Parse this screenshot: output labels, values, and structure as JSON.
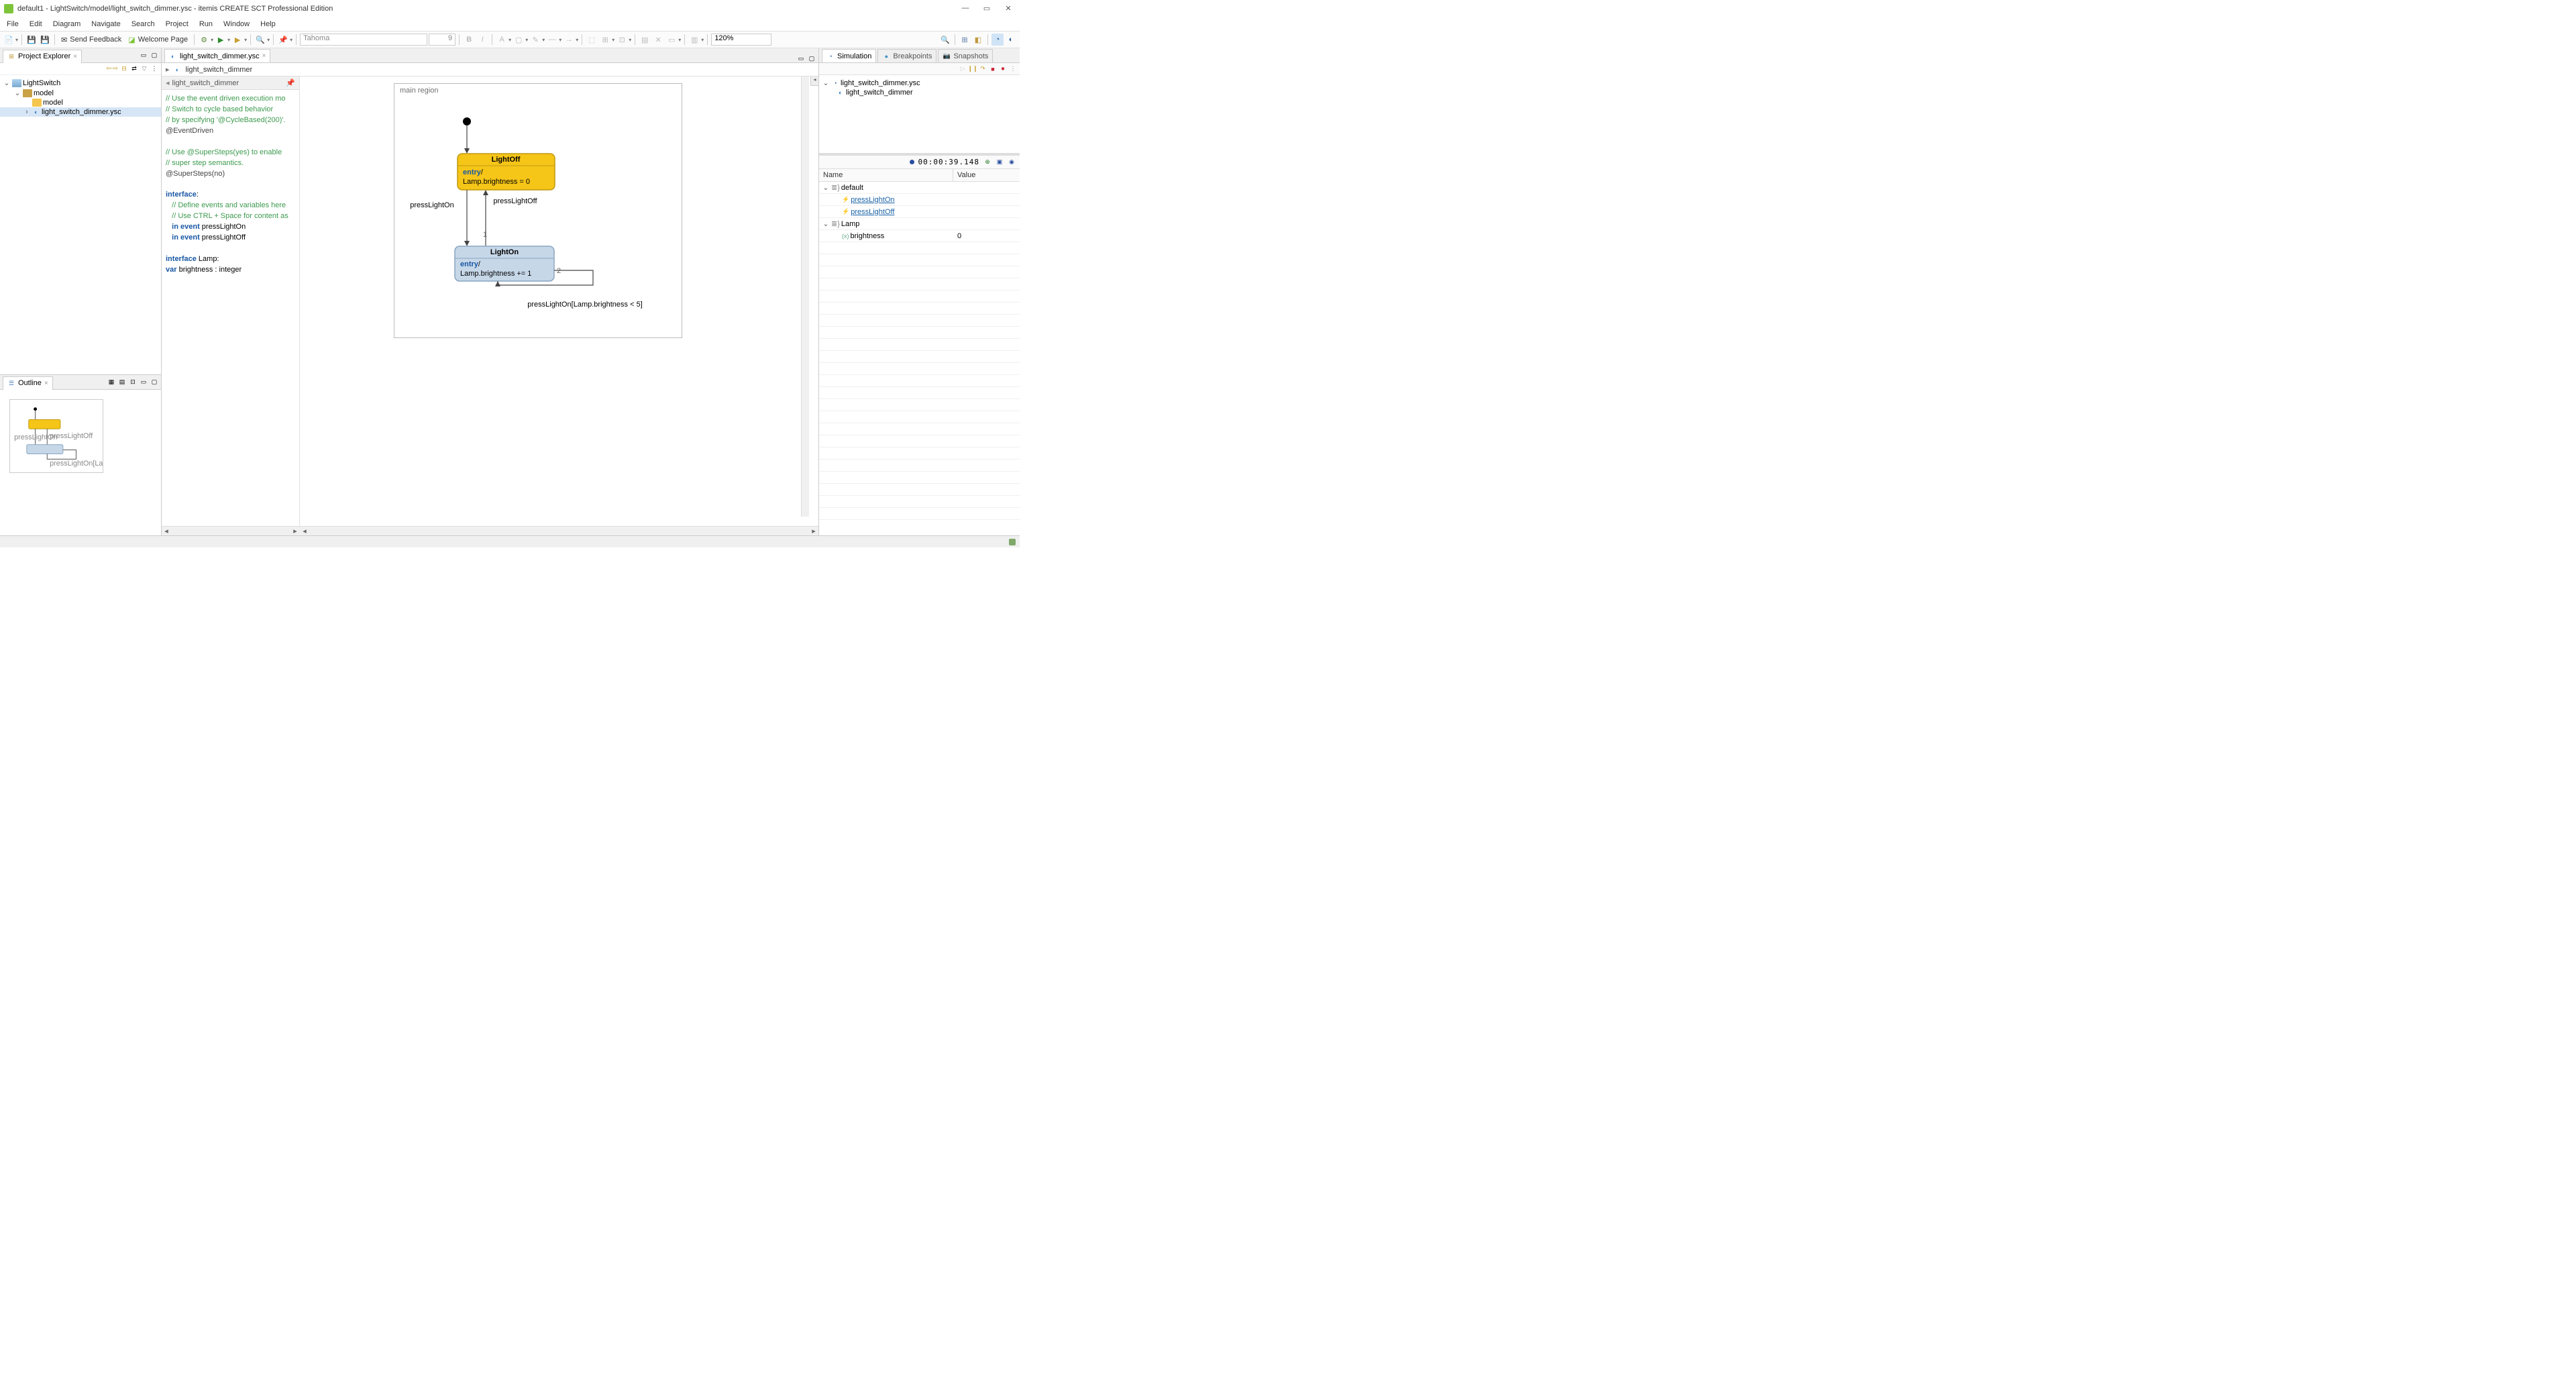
{
  "window": {
    "title": "default1 - LightSwitch/model/light_switch_dimmer.ysc - itemis CREATE SCT Professional Edition"
  },
  "menu": [
    "File",
    "Edit",
    "Diagram",
    "Navigate",
    "Search",
    "Project",
    "Run",
    "Window",
    "Help"
  ],
  "toolbar": {
    "send_feedback": "Send Feedback",
    "welcome_page": "Welcome Page",
    "font": "Tahoma",
    "font_size": "9",
    "zoom": "120%"
  },
  "project_explorer": {
    "title": "Project Explorer",
    "tree": {
      "root": "LightSwitch",
      "model_pkg": "model",
      "model_folder": "model",
      "file": "light_switch_dimmer.ysc"
    }
  },
  "outline": {
    "title": "Outline"
  },
  "editor": {
    "tab": "light_switch_dimmer.ysc",
    "crumb": "light_switch_dimmer",
    "def_header": "light_switch_dimmer",
    "region_label": "main region",
    "state_off": {
      "title": "LightOff",
      "entry": "entry",
      "body": "Lamp.brightness = 0"
    },
    "state_on": {
      "title": "LightOn",
      "entry": "entry",
      "body": "Lamp.brightness += 1"
    },
    "t_on": "pressLightOn",
    "t_off": "pressLightOff",
    "t_self": "pressLightOn[Lamp.brightness < 5]",
    "lbl1": "1",
    "lbl2": "2",
    "definition": {
      "c1": "// Use the event driven execution mo",
      "c2": "// Switch to cycle based behavior",
      "c3": "// by specifying '@CycleBased(200)'.",
      "a1": "@EventDriven",
      "c4": "// Use @SuperSteps(yes) to enable",
      "c5": "// super step semantics.",
      "a2": "@SuperSteps(no)",
      "k_iface": "interface",
      "colon": ":",
      "c6": "// Define events and variables here",
      "c7": "// Use CTRL + Space for content as",
      "k_inev": "in event",
      "ev1": " pressLightOn",
      "ev2": " pressLightOff",
      "lamp": " Lamp:",
      "k_var": "var",
      "vardef": " brightness : integer"
    }
  },
  "right": {
    "tabs": {
      "sim": "Simulation",
      "bp": "Breakpoints",
      "snap": "Snapshots"
    },
    "sim_tree": {
      "root": "light_switch_dimmer.ysc",
      "child": "light_switch_dimmer"
    },
    "time": "00:00:39.148",
    "vars": {
      "h_name": "Name",
      "h_value": "Value",
      "default": "default",
      "ev1": "pressLightOn",
      "ev2": "pressLightOff",
      "lamp": "Lamp",
      "bright": "brightness",
      "bright_val": "0"
    }
  }
}
